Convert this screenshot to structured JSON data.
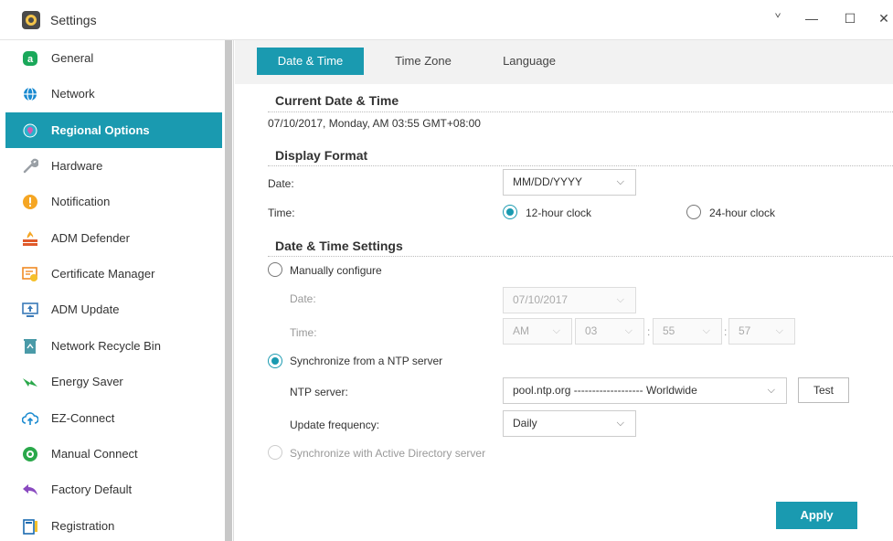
{
  "window": {
    "title": "Settings",
    "controls": {
      "pin": "ᘁ",
      "minimize": "—",
      "maximize": "☐",
      "close": "✕"
    }
  },
  "sidebar": {
    "items": [
      {
        "label": "General",
        "icon": "general-icon",
        "color": "#1aa85a"
      },
      {
        "label": "Network",
        "icon": "globe-icon",
        "color": "#1a8ad0"
      },
      {
        "label": "Regional Options",
        "icon": "location-icon",
        "color": "#2bb3cc",
        "active": true
      },
      {
        "label": "Hardware",
        "icon": "wrench-icon",
        "color": "#9aa0a6"
      },
      {
        "label": "Notification",
        "icon": "alert-icon",
        "color": "#f5a623"
      },
      {
        "label": "ADM Defender",
        "icon": "firewall-icon",
        "color": "#e05a2a"
      },
      {
        "label": "Certificate Manager",
        "icon": "certificate-icon",
        "color": "#f08a24"
      },
      {
        "label": "ADM Update",
        "icon": "update-icon",
        "color": "#3a7ab8"
      },
      {
        "label": "Network Recycle Bin",
        "icon": "recycle-bin-icon",
        "color": "#4a9aa8"
      },
      {
        "label": "Energy Saver",
        "icon": "energy-icon",
        "color": "#2aa84a"
      },
      {
        "label": "EZ-Connect",
        "icon": "cloud-upload-icon",
        "color": "#1a8ad0"
      },
      {
        "label": "Manual Connect",
        "icon": "connect-icon",
        "color": "#2aa84a"
      },
      {
        "label": "Factory Default",
        "icon": "undo-icon",
        "color": "#8a4ac0"
      },
      {
        "label": "Registration",
        "icon": "registration-icon",
        "color": "#1a6ab0"
      }
    ]
  },
  "tabs": [
    {
      "label": "Date & Time",
      "active": true
    },
    {
      "label": "Time Zone"
    },
    {
      "label": "Language"
    }
  ],
  "current": {
    "heading": "Current Date & Time",
    "value": "07/10/2017, Monday, AM 03:55 GMT+08:00"
  },
  "display_format": {
    "heading": "Display Format",
    "date_label": "Date:",
    "date_value": "MM/DD/YYYY",
    "time_label": "Time:",
    "clock_12": "12-hour clock",
    "clock_24": "24-hour clock",
    "selected": "12-hour clock"
  },
  "settings": {
    "heading": "Date & Time Settings",
    "manual_label": "Manually configure",
    "manual_date_label": "Date:",
    "manual_date_value": "07/10/2017",
    "manual_time_label": "Time:",
    "ampm": "AM",
    "hour": "03",
    "minute": "55",
    "second": "57",
    "sep": ":",
    "ntp_label": "Synchronize from a NTP server",
    "ntp_server_label": "NTP server:",
    "ntp_server_value": "pool.ntp.org ------------------- Worldwide",
    "test_label": "Test",
    "frequency_label": "Update frequency:",
    "frequency_value": "Daily",
    "ad_label": "Synchronize with Active Directory server",
    "selected": "Synchronize from a NTP server"
  },
  "apply_label": "Apply",
  "chevron": "⌵",
  "accent": "#1a9ab0"
}
